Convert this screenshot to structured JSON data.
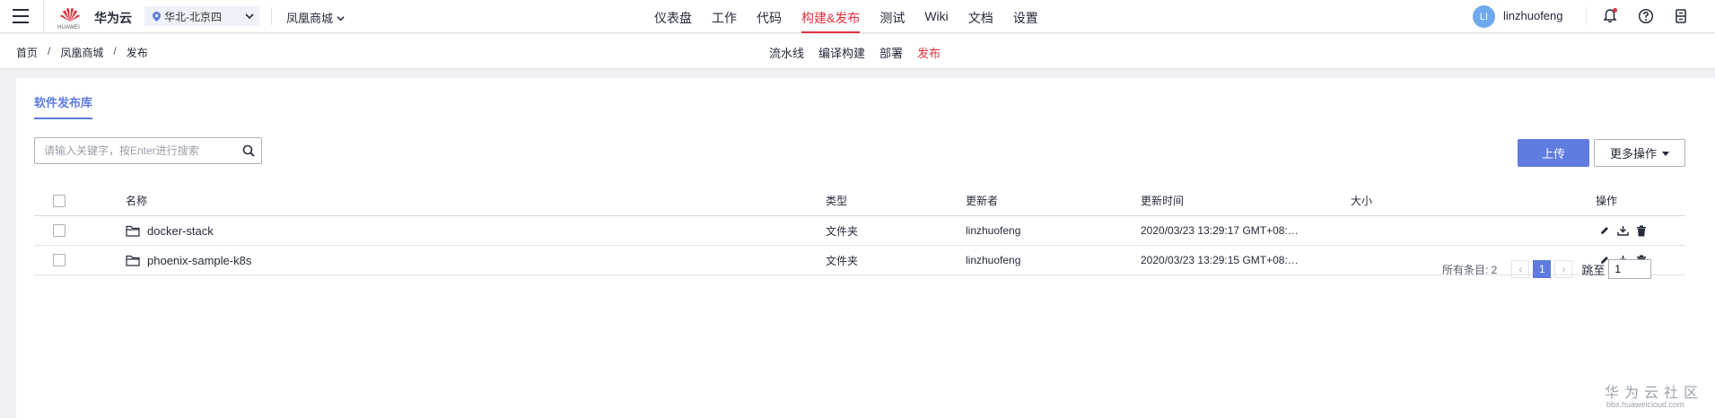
{
  "header": {
    "brand": "华为云",
    "logo_text": "HUAWEI",
    "region": "华北-北京四",
    "project": "凤凰商城",
    "nav": [
      "仪表盘",
      "工作",
      "代码",
      "构建&发布",
      "测试",
      "Wiki",
      "文档",
      "设置"
    ],
    "active_nav": "构建&发布",
    "user": {
      "initials": "LI",
      "name": "linzhuofeng"
    }
  },
  "breadcrumb": [
    "首页",
    "凤凰商城",
    "发布"
  ],
  "subnav": [
    "流水线",
    "编译构建",
    "部署",
    "发布"
  ],
  "active_subnav": "发布",
  "tab": "软件发布库",
  "search": {
    "placeholder": "请输入关键字，按Enter进行搜索",
    "value": ""
  },
  "buttons": {
    "upload": "上传",
    "more": "更多操作"
  },
  "table": {
    "headers": [
      "名称",
      "类型",
      "更新者",
      "更新时间",
      "大小",
      "操作"
    ],
    "rows": [
      {
        "name": "docker-stack",
        "type": "文件夹",
        "updater": "linzhuofeng",
        "time": "2020/03/23 13:29:17 GMT+08:…",
        "size": ""
      },
      {
        "name": "phoenix-sample-k8s",
        "type": "文件夹",
        "updater": "linzhuofeng",
        "time": "2020/03/23 13:29:15 GMT+08:…",
        "size": ""
      }
    ]
  },
  "pagination": {
    "total_label": "所有条目: 2",
    "current_page": "1",
    "goto_label": "跳至",
    "goto_value": "1"
  },
  "watermark": {
    "title": "华为云社区",
    "url": "bbs.huaweicloud.com"
  },
  "colors": {
    "accent": "#5e7ce0",
    "active_nav": "#e0313d",
    "avatar": "#6ea8ef"
  }
}
